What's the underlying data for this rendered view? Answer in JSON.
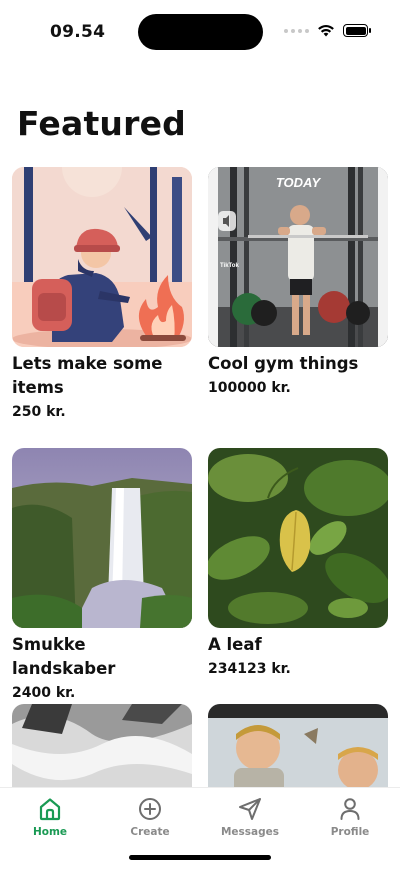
{
  "status": {
    "time": "09.54"
  },
  "page": {
    "title": "Featured"
  },
  "products": [
    {
      "name": "Lets make some items",
      "price": "250 kr.",
      "image": "illustration-hiker-campfire"
    },
    {
      "name": "Cool gym things",
      "price": "100000 kr.",
      "image": "tiktok-gym-video",
      "overlay_text": "TODAY",
      "watermark": "TikTok"
    },
    {
      "name": "Smukke landskaber",
      "price": "2400 kr.",
      "image": "waterfall-landscape"
    },
    {
      "name": "A leaf",
      "price": "234123 kr.",
      "image": "green-leaves"
    },
    {
      "name": "",
      "price": "",
      "image": "rushing-water-bw"
    },
    {
      "name": "",
      "price": "",
      "image": "children-playing"
    }
  ],
  "tabbar": {
    "accent": "#1a9a54",
    "inactive": "#8a8a8a",
    "tabs": [
      {
        "label": "Home",
        "icon": "home-icon",
        "active": true
      },
      {
        "label": "Create",
        "icon": "plus-circle-icon",
        "active": false
      },
      {
        "label": "Messages",
        "icon": "send-icon",
        "active": false
      },
      {
        "label": "Profile",
        "icon": "user-icon",
        "active": false
      }
    ]
  }
}
